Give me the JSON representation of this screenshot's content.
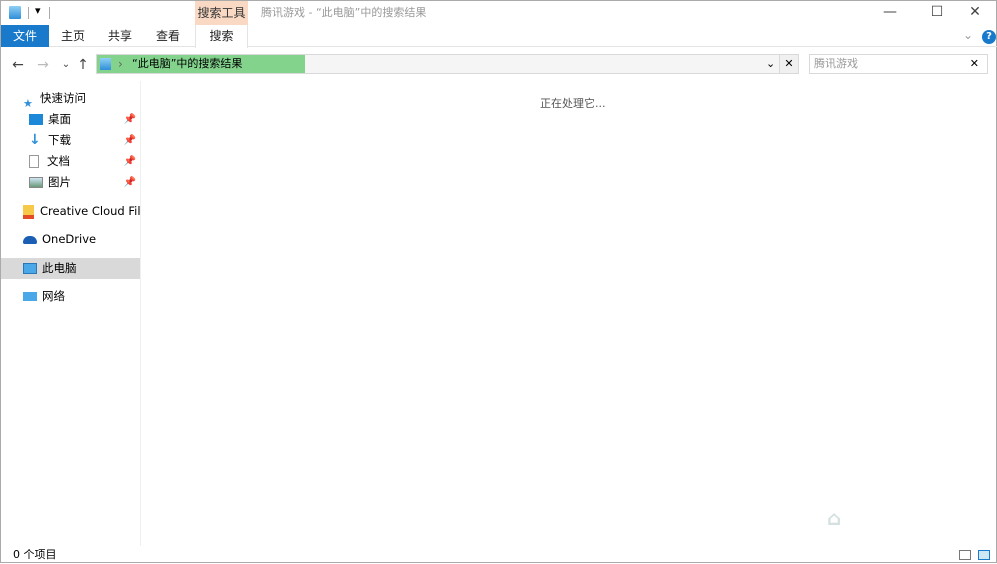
{
  "titlebar": {
    "title": "腾讯游戏 - “此电脑”中的搜索结果",
    "context_tab": "搜索工具",
    "minimize": "—",
    "maximize": "☐",
    "close": "✕",
    "qat_dropdown": "▾"
  },
  "ribbon": {
    "tabs": [
      "文件",
      "主页",
      "共享",
      "查看",
      "搜索"
    ],
    "collapse": "⌄",
    "help": "?"
  },
  "nav": {
    "back": "←",
    "forward": "→",
    "recent": "⌄",
    "up": "↑",
    "sep": "›",
    "address": "“此电脑”中的搜索结果",
    "dropdown": "⌄",
    "clear": "✕"
  },
  "search": {
    "value": "腾讯游戏",
    "clear": "✕"
  },
  "sidebar": {
    "items": [
      {
        "label": "快速访问"
      },
      {
        "label": "桌面",
        "pinned": true
      },
      {
        "label": "下载",
        "pinned": true
      },
      {
        "label": "文档",
        "pinned": true
      },
      {
        "label": "图片",
        "pinned": true
      },
      {
        "label": "Creative Cloud Files"
      },
      {
        "label": "OneDrive"
      },
      {
        "label": "此电脑",
        "selected": true
      },
      {
        "label": "网络"
      }
    ]
  },
  "main": {
    "status_message": "正在处理它..."
  },
  "statusbar": {
    "count": "0 个项目"
  },
  "colors": {
    "accent": "#1979ca",
    "context": "#f9d9c4",
    "highlight": "#83d38d"
  }
}
